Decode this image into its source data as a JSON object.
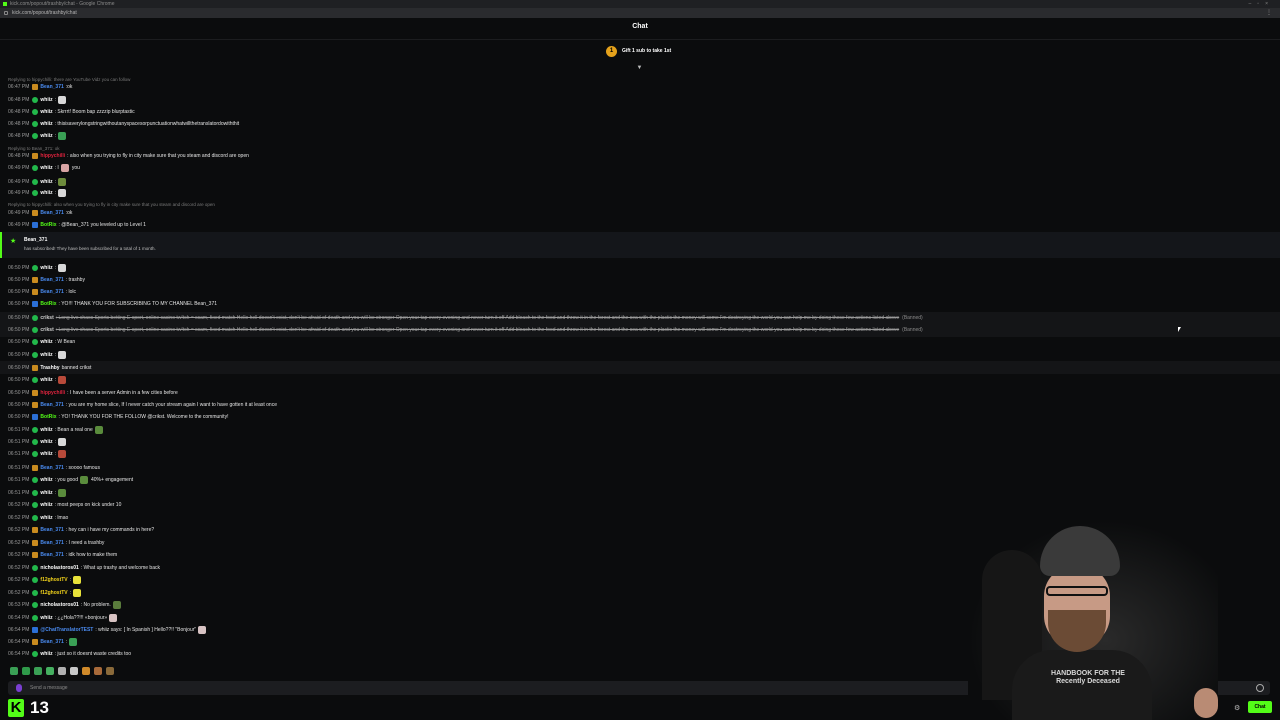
{
  "browser": {
    "window_title": "kick.com/popout/trashby/chat - Google Chrome",
    "url": "kick.com/popout/trashby/chat"
  },
  "header": {
    "title": "Chat"
  },
  "pinned": {
    "badge": "1",
    "text": "Gift 1 sub to take 1st"
  },
  "subscription": {
    "user": "Bean_371",
    "text": "has subscribed! They have been subscribed for a total of 1 month."
  },
  "messages": [
    {
      "type": "reply",
      "text": "Replying to hippychilli: there are YouTube Vidz you can follow"
    },
    {
      "time": "06:47 PM",
      "user": "Bean_371",
      "user_color": "#4a8bf0",
      "text": ":ok"
    },
    {
      "time": "06:48 PM",
      "user": "whiiz",
      "user_color": "#ffffff",
      "text": ":",
      "emote": "#d8d8d8"
    },
    {
      "time": "06:48 PM",
      "user": "whiiz",
      "user_color": "#ffffff",
      "text": ": Skrrrt! Boom bap zzzzip blurptastic"
    },
    {
      "time": "06:48 PM",
      "user": "whiiz",
      "user_color": "#ffffff",
      "text": ": thisisaverylongstringwithoutanyspacesorpunctuationwhatwillthetranslatordowiththit"
    },
    {
      "time": "06:48 PM",
      "user": "whiiz",
      "user_color": "#ffffff",
      "text": ":",
      "emote": "#3aa055"
    },
    {
      "type": "reply",
      "text": "Replying to Bean_371: ok"
    },
    {
      "time": "06:48 PM",
      "user": "hippychilli",
      "user_color": "#e0233e",
      "text": ": also when you trying to fly in city make sure that you steam and discord are open"
    },
    {
      "time": "06:49 PM",
      "user": "whiiz",
      "user_color": "#ffffff",
      "text": ": I",
      "emote": "#d8a3a3",
      "suffix": "you"
    },
    {
      "time": "06:49 PM",
      "user": "whiiz",
      "user_color": "#ffffff",
      "text": ":",
      "emote": "#6e8c3c"
    },
    {
      "time": "06:49 PM",
      "user": "whiiz",
      "user_color": "#ffffff",
      "text": ":",
      "emote": "#d8d8d8"
    },
    {
      "type": "reply",
      "text": "Replying to hippychilli: also when you trying to fly in city make sure that you steam and discord are open"
    },
    {
      "time": "06:49 PM",
      "user": "Bean_371",
      "user_color": "#4a8bf0",
      "text": ":ok"
    },
    {
      "time": "06:49 PM",
      "user": "BotRix",
      "user_color": "#53fc18",
      "text": ": @Bean_371 you leveled up to Level 1"
    },
    {
      "time": "06:50 PM",
      "user": "whiiz",
      "user_color": "#ffffff",
      "text": ":",
      "emote": "#d8d8d8"
    },
    {
      "time": "06:50 PM",
      "user": "Bean_371",
      "user_color": "#4a8bf0",
      "text": ": trashby"
    },
    {
      "time": "06:50 PM",
      "user": "Bean_371",
      "user_color": "#4a8bf0",
      "text": ": lolc"
    },
    {
      "time": "06:50 PM",
      "user": "BotRix",
      "user_color": "#53fc18",
      "text": ": YO!!! THANK YOU FOR SUBSCRIBING TO MY CHANNEL Bean_371"
    },
    {
      "time": "06:50 PM",
      "user": "crikst",
      "user_color": "#cfcfcf",
      "struck": true,
      "text": ": Long live chaos Sports betting E-sport, online casino tw!tch = scam, fixed match Hello hell doesn't exist, don't be afraid of death and you will be stronger Open your tap every evening and never turn it off Add bleach to the food and throw it in the forest and the sea with the plastic the money will come I'm destroying the world you can help me by doing these few actions listed above",
      "banned": "(Banned)"
    },
    {
      "time": "06:50 PM",
      "user": "crikst",
      "user_color": "#cfcfcf",
      "struck": true,
      "text": ": Long live chaos Sports betting E-sport, online casino tw!tch = scam, fixed match Hello hell doesn't exist, don't be afraid of death and you will be stronger Open your tap every evening and never turn it off Add bleach to the food and throw it in the forest and the sea with the plastic the money will come I'm destroying the world you can help me by doing these few actions listed above",
      "banned": "(Banned)"
    },
    {
      "time": "06:50 PM",
      "user": "whiiz",
      "user_color": "#ffffff",
      "text": ": W Bean"
    },
    {
      "time": "06:50 PM",
      "user": "whiiz",
      "user_color": "#ffffff",
      "text": ":",
      "emote": "#d8d8d8"
    },
    {
      "time": "06:50 PM",
      "user": "Trashby",
      "user_color": "#ffffff",
      "text": " banned crikst",
      "system": true
    },
    {
      "time": "06:50 PM",
      "user": "whiiz",
      "user_color": "#ffffff",
      "text": ":",
      "emote": "#b84a3a"
    },
    {
      "time": "06:50 PM",
      "user": "hippychilli",
      "user_color": "#e0233e",
      "text": ": I have been a server Admin in a few cities before"
    },
    {
      "time": "06:50 PM",
      "user": "Bean_371",
      "user_color": "#4a8bf0",
      "text": ": you are my home slice, If I never catch your stream again I want to have gotten it at least once"
    },
    {
      "time": "06:50 PM",
      "user": "BotRix",
      "user_color": "#53fc18",
      "text": ": YO! THANK YOU FOR THE FOLLOW @crikst. Welcome to the community!"
    },
    {
      "time": "06:51 PM",
      "user": "whiiz",
      "user_color": "#ffffff",
      "text": ": Bean a real one",
      "emote": "#5a8c3c"
    },
    {
      "time": "06:51 PM",
      "user": "whiiz",
      "user_color": "#ffffff",
      "text": ":",
      "emote": "#d8d8d8"
    },
    {
      "time": "06:51 PM",
      "user": "whiiz",
      "user_color": "#ffffff",
      "text": ":",
      "emote": "#b84a3a"
    },
    {
      "time": "06:51 PM",
      "user": "Bean_371",
      "user_color": "#4a8bf0",
      "text": ": soooo famous"
    },
    {
      "time": "06:51 PM",
      "user": "whiiz",
      "user_color": "#ffffff",
      "text": ": you good",
      "emote": "#5a8c3c",
      "suffix": "40%+ engagement"
    },
    {
      "time": "06:51 PM",
      "user": "whiiz",
      "user_color": "#ffffff",
      "text": ":",
      "emote": "#5a8c3c"
    },
    {
      "time": "06:52 PM",
      "user": "whiiz",
      "user_color": "#ffffff",
      "text": ": most peeps on kick under 10"
    },
    {
      "time": "06:52 PM",
      "user": "whiiz",
      "user_color": "#ffffff",
      "text": ": lmao"
    },
    {
      "time": "06:52 PM",
      "user": "Bean_371",
      "user_color": "#4a8bf0",
      "text": ": hey can i have my commands in here?"
    },
    {
      "time": "06:52 PM",
      "user": "Bean_371",
      "user_color": "#4a8bf0",
      "text": ": I need a trashby"
    },
    {
      "time": "06:52 PM",
      "user": "Bean_371",
      "user_color": "#4a8bf0",
      "text": ": idk how to make them"
    },
    {
      "time": "06:52 PM",
      "user": "nicholastoros01",
      "user_color": "#ffffff",
      "text": ": What up trashy and welcome back"
    },
    {
      "time": "06:52 PM",
      "user": "f12ghostTV",
      "user_color": "#f2d31b",
      "text": ":",
      "emote": "#e8e23a"
    },
    {
      "time": "06:52 PM",
      "user": "f12ghostTV",
      "user_color": "#f2d31b",
      "text": ":",
      "emote": "#e8e23a"
    },
    {
      "time": "06:53 PM",
      "user": "nicholastoros01",
      "user_color": "#ffffff",
      "text": ": No problem.",
      "emote": "#5a7c3c"
    },
    {
      "time": "06:54 PM",
      "user": "whiiz",
      "user_color": "#ffffff",
      "text": ": ¿¿Hola??!!! «bonjour»",
      "emote": "#d8c3c3"
    },
    {
      "time": "06:54 PM",
      "user": "@ChatTranslatorTEST",
      "user_color": "#4a8bf0",
      "text": ": whiiz says: [ In Spanish ] Hello??!! \"Bonjour\"",
      "emote": "#d8c3c3"
    },
    {
      "time": "06:54 PM",
      "user": "Bean_371",
      "user_color": "#4a8bf0",
      "text": ":",
      "emote": "#3aa055"
    },
    {
      "time": "06:54 PM",
      "user": "whiiz",
      "user_color": "#ffffff",
      "text": ": just so it doesnt waste credits too"
    }
  ],
  "input": {
    "placeholder": "Send a message"
  },
  "footer": {
    "logo": "K",
    "viewer_count": "13",
    "chat_button": "Chat"
  },
  "webcam": {
    "shirt_text": "HANDBOOK FOR THE Recently Deceased"
  }
}
